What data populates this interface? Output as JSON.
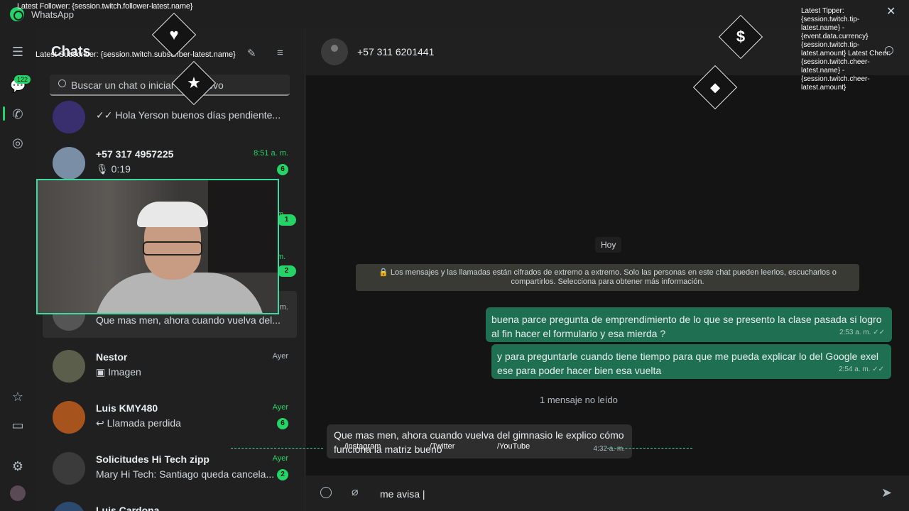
{
  "titlebar": {
    "app_name": "WhatsApp",
    "overlay_follower": "Latest Follower: {session.twitch.follower-latest.name}"
  },
  "rail": {
    "chats_badge": "122"
  },
  "chatlist": {
    "title": "Chats",
    "overlay_subscriber": "Latest Subscriber: {session.twitch.subscriber-latest.name}",
    "search_placeholder": "Buscar un chat o iniciar uno nuevo",
    "items": [
      {
        "name": "",
        "preview": "✓✓ Hola Yerson buenos días pendiente...",
        "time": "",
        "badge": ""
      },
      {
        "name": "+57 317 4957225",
        "preview": "🎙 0:19",
        "time": "8:51 a. m.",
        "badge": "6"
      },
      {
        "name": "",
        "preview": "Que mas men, ahora cuando vuelva del...",
        "time": "m.",
        "badge": ""
      },
      {
        "name": "Nestor",
        "preview": "▣ Imagen",
        "time": "Ayer",
        "badge": ""
      },
      {
        "name": "Luis KMY480",
        "preview": "↩ Llamada perdida",
        "time": "Ayer",
        "badge": "6"
      },
      {
        "name": "Solicitudes Hi Tech zipp",
        "preview": "Mary Hi Tech: Santiago queda cancela...",
        "time": "Ayer",
        "badge": "2"
      },
      {
        "name": "Luis Cardona",
        "preview": "",
        "time": "",
        "badge": ""
      }
    ],
    "hidden_times": [
      "m.",
      "m."
    ],
    "hidden_badges": [
      "1",
      "2"
    ]
  },
  "conversation": {
    "contact": "+57 311 6201441",
    "day_label": "Hoy",
    "encryption_notice": "🔒 Los mensajes y las llamadas están cifrados de extremo a extremo. Solo las personas en este chat pueden leerlos, escucharlos o compartirlos. Selecciona para obtener más información.",
    "messages": [
      {
        "text": "buena parce pregunta de emprendimiento de lo que se presento la clase pasada si logro al fin hacer el formulario y esa mierda ?",
        "time": "2:53 a. m. ✓✓"
      },
      {
        "text": "y para preguntarle cuando tiene tiempo para que me pueda explicar lo del Google exel ese para poder hacer bien esa vuelta",
        "time": "2:54 a. m. ✓✓"
      }
    ],
    "unread_label": "1 mensaje no leído",
    "incoming": {
      "text": "Que mas men, ahora cuando vuelva del gimnasio le explico cómo funciona la matriz bueno",
      "time": "4:32 a. m."
    },
    "composer_value": "me avisa |",
    "overlay_tipper": "Latest Tipper: {session.twitch.tip-latest.name} - {event.data.currency}{session.twitch.tip-latest.amount} Latest Cheer: {session.twitch.cheer-latest.name} - {session.twitch.cheer-latest.amount}"
  },
  "social": {
    "instagram": "/instagram",
    "twitter": "/Twitter",
    "youtube": "/YouTube"
  },
  "alerts": {
    "heart": "♥",
    "star": "★",
    "dollar": "$",
    "gem": "◆"
  }
}
